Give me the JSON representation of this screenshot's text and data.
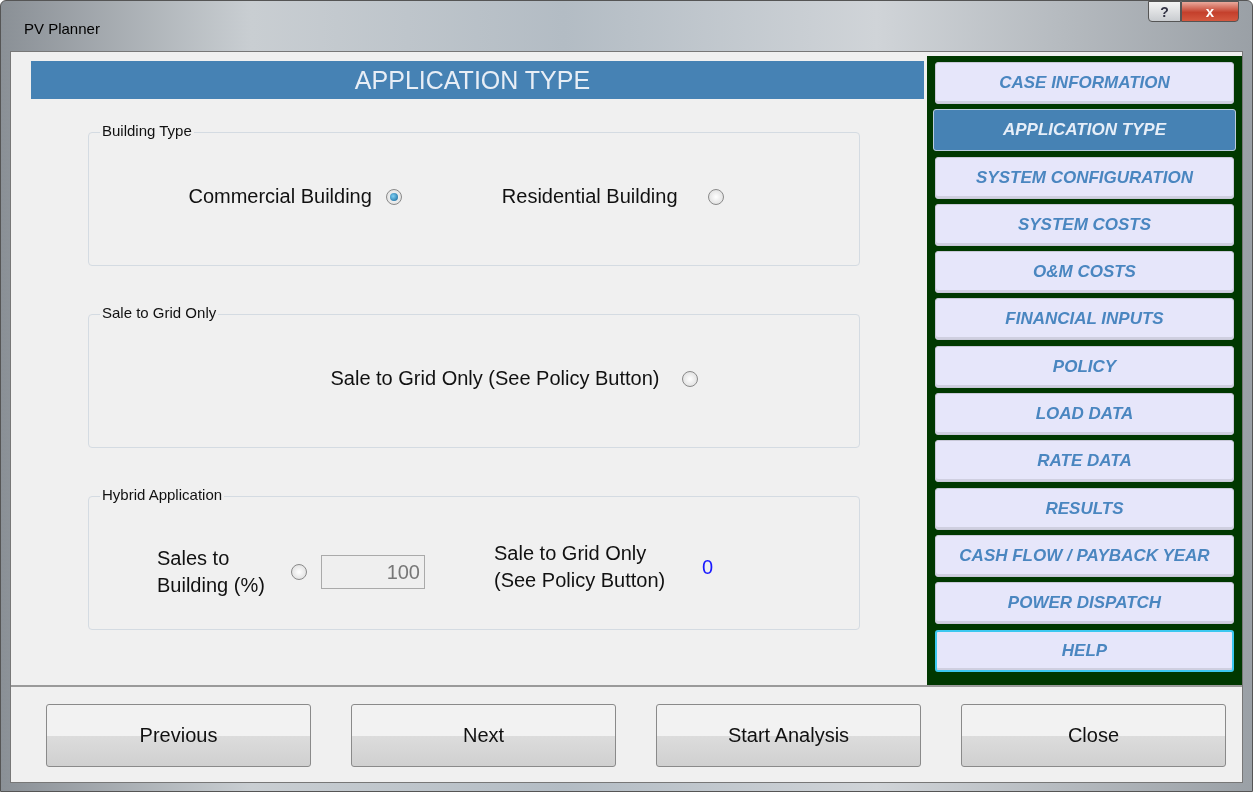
{
  "window": {
    "title": "PV Planner",
    "controls": [
      {
        "kind": "help",
        "label": "?"
      },
      {
        "kind": "close",
        "label": "x"
      }
    ]
  },
  "header": {
    "title": "APPLICATION TYPE"
  },
  "groups": [
    {
      "kind": "choice",
      "title": "Building Type",
      "options": [
        {
          "label": "Commercial Building",
          "selected": true
        },
        {
          "label": "Residential Building",
          "selected": false
        }
      ]
    },
    {
      "kind": "choice",
      "title": "Sale to Grid Only",
      "options": [
        {
          "label": "Sale to Grid Only (See Policy Button)",
          "selected": false
        }
      ]
    },
    {
      "kind": "hybrid",
      "title": "Hybrid Application",
      "option": {
        "label": "Sales to Building (%)",
        "selected": false
      },
      "field": {
        "value": "100",
        "disabled": true
      },
      "readout": {
        "label": "Sale to Grid Only (See Policy Button)",
        "value": "0"
      }
    }
  ],
  "sidebar": {
    "items": [
      {
        "label": "CASE INFORMATION",
        "selected": false,
        "focused": false
      },
      {
        "label": "APPLICATION TYPE",
        "selected": true,
        "focused": false
      },
      {
        "label": "SYSTEM CONFIGURATION",
        "selected": false,
        "focused": false
      },
      {
        "label": "SYSTEM COSTS",
        "selected": false,
        "focused": false
      },
      {
        "label": "O&M COSTS",
        "selected": false,
        "focused": false
      },
      {
        "label": "FINANCIAL INPUTS",
        "selected": false,
        "focused": false
      },
      {
        "label": "POLICY",
        "selected": false,
        "focused": false
      },
      {
        "label": "LOAD DATA",
        "selected": false,
        "focused": false
      },
      {
        "label": "RATE DATA",
        "selected": false,
        "focused": false
      },
      {
        "label": "RESULTS",
        "selected": false,
        "focused": false
      },
      {
        "label": "CASH FLOW / PAYBACK YEAR",
        "selected": false,
        "focused": false
      },
      {
        "label": "POWER DISPATCH",
        "selected": false,
        "focused": false
      },
      {
        "label": "HELP",
        "selected": false,
        "focused": true
      }
    ]
  },
  "buttons": [
    "Previous",
    "Next",
    "Start Analysis",
    "Close"
  ]
}
